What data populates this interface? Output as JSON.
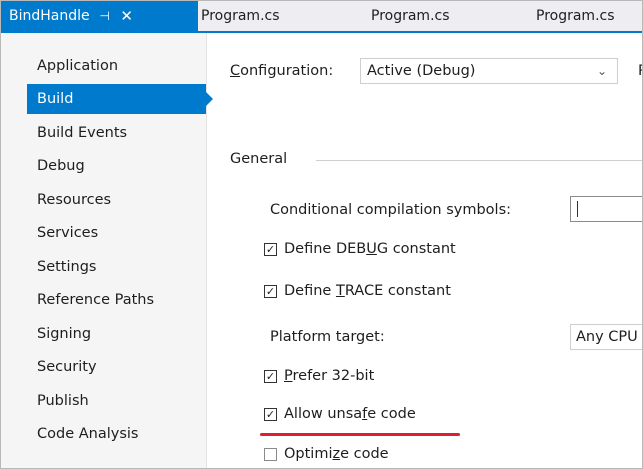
{
  "tabs": {
    "active": {
      "label": "BindHandle",
      "pin_icon": "pin-icon",
      "close_icon": "close-icon"
    },
    "others": [
      "Program.cs",
      "Program.cs",
      "Program.cs"
    ]
  },
  "sidebar": {
    "items": [
      {
        "label": "Application"
      },
      {
        "label": "Build",
        "selected": true
      },
      {
        "label": "Build Events"
      },
      {
        "label": "Debug"
      },
      {
        "label": "Resources"
      },
      {
        "label": "Services"
      },
      {
        "label": "Settings"
      },
      {
        "label": "Reference Paths"
      },
      {
        "label": "Signing"
      },
      {
        "label": "Security"
      },
      {
        "label": "Publish"
      },
      {
        "label": "Code Analysis"
      }
    ]
  },
  "main": {
    "configuration": {
      "label_pre": "",
      "label_u": "C",
      "label_post": "onfiguration:",
      "value": "Active (Debug)",
      "next_label": "P"
    },
    "general": {
      "title": "General"
    },
    "conditional_symbols": {
      "label": "Conditional compilation symbols:",
      "value": ""
    },
    "define_debug": {
      "pre": "Define DEB",
      "u": "U",
      "post": "G constant",
      "checked": true
    },
    "define_trace": {
      "pre": "Define ",
      "u": "T",
      "post": "RACE constant",
      "checked": true
    },
    "platform_target": {
      "label": "Platform target:",
      "value": "Any CPU"
    },
    "prefer_32bit": {
      "pre": "",
      "u": "P",
      "post": "refer 32-bit",
      "checked": true
    },
    "allow_unsafe": {
      "pre": "Allow unsa",
      "u": "f",
      "post": "e code",
      "checked": true
    },
    "optimize": {
      "pre": "Optimi",
      "u": "z",
      "post": "e code",
      "checked": false
    }
  },
  "colors": {
    "accent": "#007acc",
    "highlight_underline": "#e01e2f"
  }
}
